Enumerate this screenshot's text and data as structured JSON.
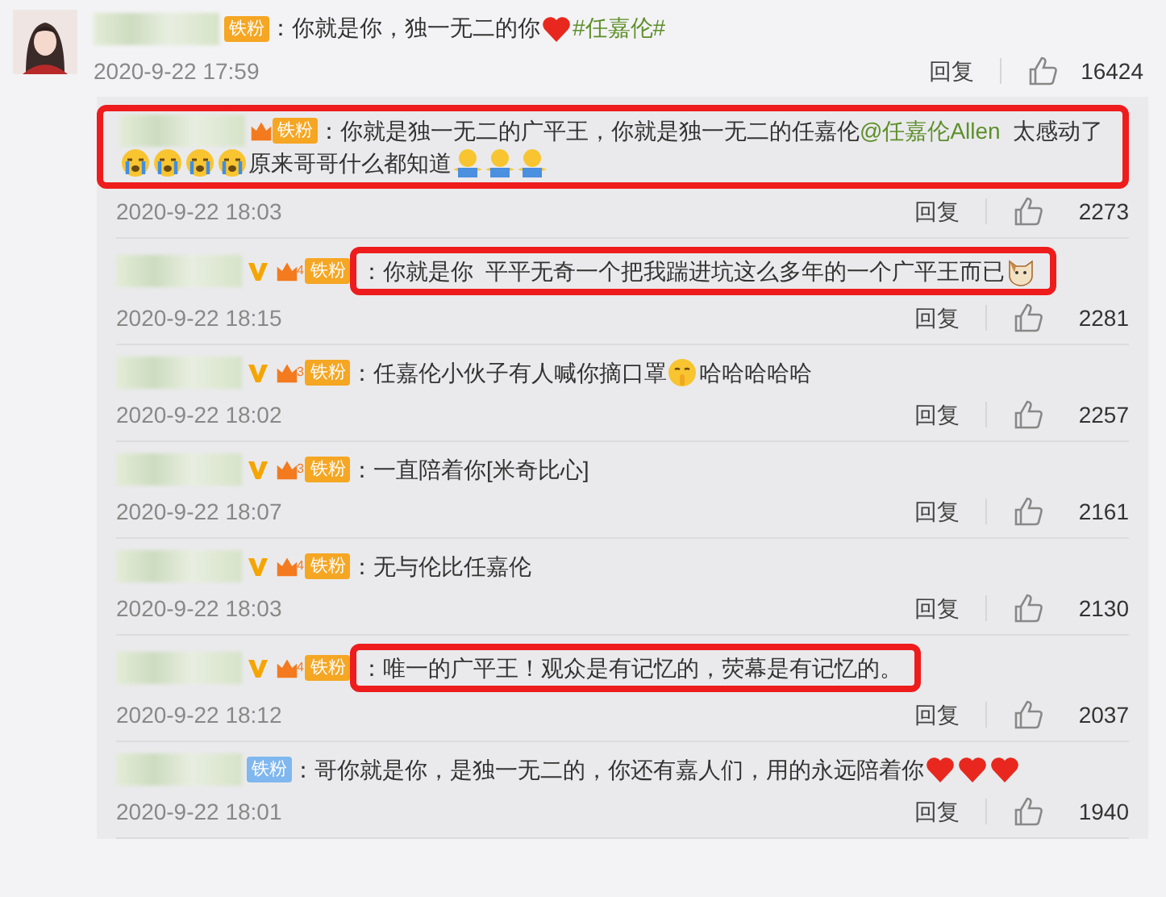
{
  "comment": {
    "badge": {
      "label": "铁粉",
      "color": "#f5a623",
      "crown": false
    },
    "segments": [
      {
        "kind": "text",
        "text": "：你就是你，独一无二的你"
      },
      {
        "kind": "heart"
      },
      {
        "kind": "hashtag",
        "text": "#任嘉伦#"
      }
    ],
    "date": "2020-9-22 17:59",
    "reply_label": "回复",
    "likes": "16424"
  },
  "replies": [
    {
      "kind": "row_highlighted",
      "verified": false,
      "badge": {
        "label": "铁粉",
        "color": "#f5a623",
        "crown": true
      },
      "segments": [
        {
          "kind": "text",
          "text": "：你就是独一无二的广平王，你就是独一无二的任嘉伦"
        },
        {
          "kind": "mention",
          "text": "@任嘉伦Allen"
        },
        {
          "kind": "text",
          "text": "  太感动了"
        },
        {
          "kind": "crying"
        },
        {
          "kind": "crying"
        },
        {
          "kind": "crying"
        },
        {
          "kind": "crying"
        },
        {
          "kind": "text",
          "text": "原来哥哥什么都知道"
        },
        {
          "kind": "figure"
        },
        {
          "kind": "figure"
        },
        {
          "kind": "figure"
        }
      ],
      "date": "2020-9-22 18:03",
      "reply_label": "回复",
      "likes": "2273"
    },
    {
      "kind": "text_highlighted",
      "verified": true,
      "badge": {
        "label": "铁粉",
        "color": "#f5a623",
        "crown": true,
        "rank": "4"
      },
      "segments": [
        {
          "kind": "text",
          "text": "：你就是你  平平无奇一个把我踹进坑这么多年的一个广平王而已"
        },
        {
          "kind": "cat"
        }
      ],
      "date": "2020-9-22 18:15",
      "reply_label": "回复",
      "likes": "2281"
    },
    {
      "kind": "plain",
      "verified": true,
      "badge": {
        "label": "铁粉",
        "color": "#f5a623",
        "crown": true,
        "rank": "3"
      },
      "segments": [
        {
          "kind": "text",
          "text": "：任嘉伦小伙子有人喊你摘口罩"
        },
        {
          "kind": "shush"
        },
        {
          "kind": "text",
          "text": "哈哈哈哈哈"
        }
      ],
      "date": "2020-9-22 18:02",
      "reply_label": "回复",
      "likes": "2257"
    },
    {
      "kind": "plain",
      "verified": true,
      "badge": {
        "label": "铁粉",
        "color": "#f5a623",
        "crown": true,
        "rank": "3"
      },
      "segments": [
        {
          "kind": "text",
          "text": "：一直陪着你[米奇比心]"
        }
      ],
      "date": "2020-9-22 18:07",
      "reply_label": "回复",
      "likes": "2161"
    },
    {
      "kind": "plain",
      "verified": true,
      "badge": {
        "label": "铁粉",
        "color": "#f5a623",
        "crown": true,
        "rank": "4"
      },
      "segments": [
        {
          "kind": "text",
          "text": "：无与伦比任嘉伦"
        }
      ],
      "date": "2020-9-22 18:03",
      "reply_label": "回复",
      "likes": "2130"
    },
    {
      "kind": "text_highlighted",
      "verified": true,
      "badge": {
        "label": "铁粉",
        "color": "#f5a623",
        "crown": true,
        "rank": "4"
      },
      "segments": [
        {
          "kind": "text",
          "text": "：唯一的广平王！观众是有记忆的，荧幕是有记忆的。"
        }
      ],
      "date": "2020-9-22 18:12",
      "reply_label": "回复",
      "likes": "2037"
    },
    {
      "kind": "plain",
      "verified": false,
      "badge": {
        "label": "铁粉",
        "color": "#80b7ee",
        "crown": false
      },
      "segments": [
        {
          "kind": "text",
          "text": "：哥你就是你，是独一无二的，你还有嘉人们，用的永远陪着你"
        },
        {
          "kind": "heart"
        },
        {
          "kind": "heart"
        },
        {
          "kind": "heart"
        }
      ],
      "date": "2020-9-22 18:01",
      "reply_label": "回复",
      "likes": "1940"
    }
  ]
}
